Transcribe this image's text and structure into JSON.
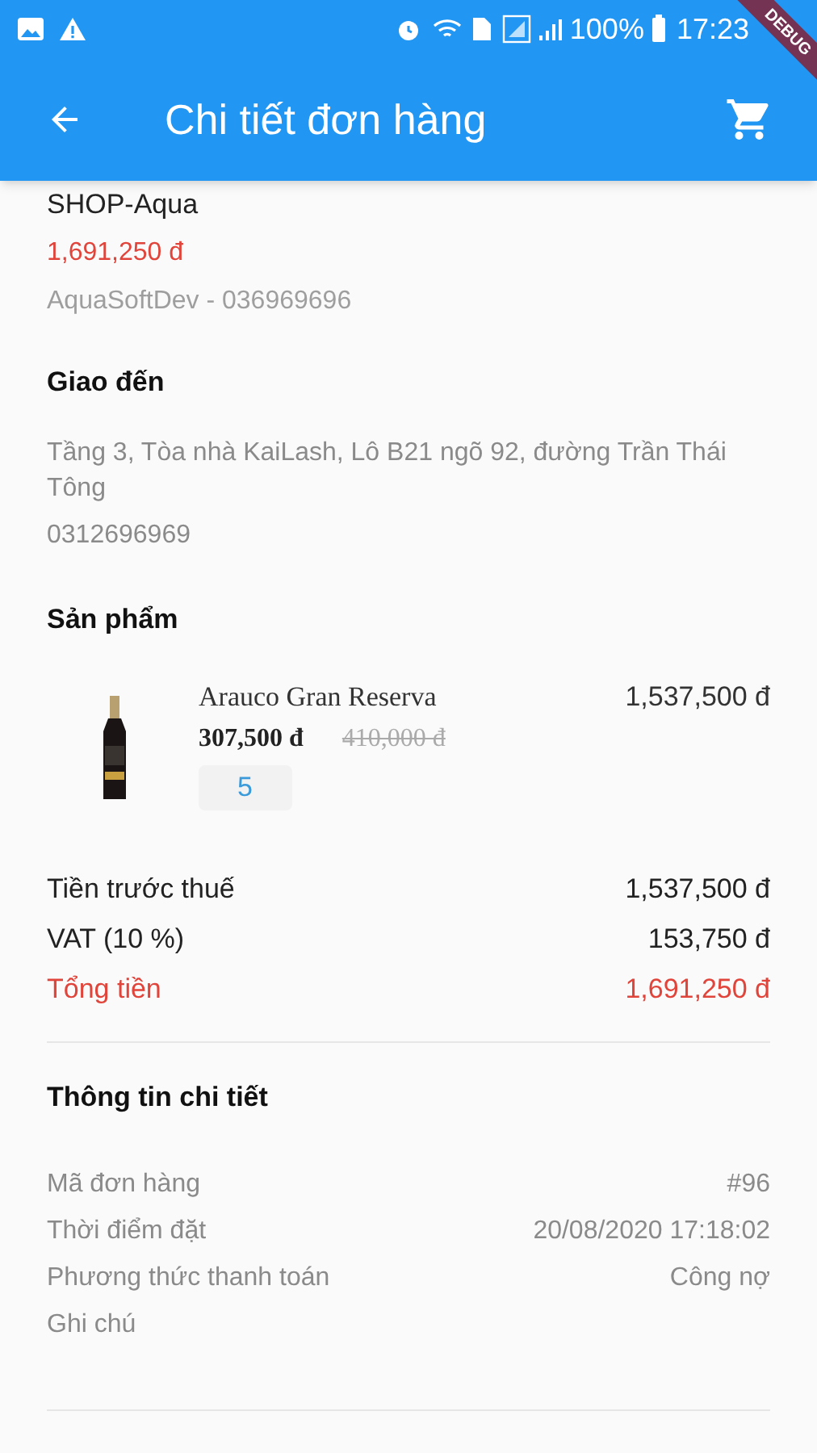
{
  "status_bar": {
    "battery": "100%",
    "time": "17:23"
  },
  "debug_banner": "DEBUG",
  "app_bar": {
    "title": "Chi tiết đơn hàng"
  },
  "shop": {
    "name": "SHOP-Aqua",
    "total": "1,691,250 đ",
    "seller": "AquaSoftDev - 036969696"
  },
  "delivery": {
    "heading": "Giao đến",
    "address": "Tầng 3, Tòa nhà KaiLash, Lô B21 ngõ 92, đường Trần Thái Tông",
    "phone": "0312696969"
  },
  "products": {
    "heading": "Sản phẩm",
    "items": [
      {
        "kind": "picture",
        "name": "Arauco Gran Reserva",
        "price": "307,500 đ",
        "old_price": "410,000 đ",
        "quantity": "5",
        "line_total": "1,537,500 đ"
      }
    ]
  },
  "totals": [
    {
      "label": "Tiền trước thuế",
      "value": "1,537,500 đ",
      "highlight": false
    },
    {
      "label": "VAT (10 %)",
      "value": "153,750 đ",
      "highlight": false
    },
    {
      "label": "Tổng tiền",
      "value": "1,691,250 đ",
      "highlight": true
    }
  ],
  "details": {
    "heading": "Thông tin chi tiết",
    "rows": [
      {
        "label": "Mã đơn hàng",
        "value": "#96"
      },
      {
        "label": "Thời điểm đặt",
        "value": "20/08/2020 17:18:02"
      },
      {
        "label": "Phương thức thanh toán",
        "value": "Công nợ"
      },
      {
        "label": "Ghi chú"
      }
    ]
  }
}
